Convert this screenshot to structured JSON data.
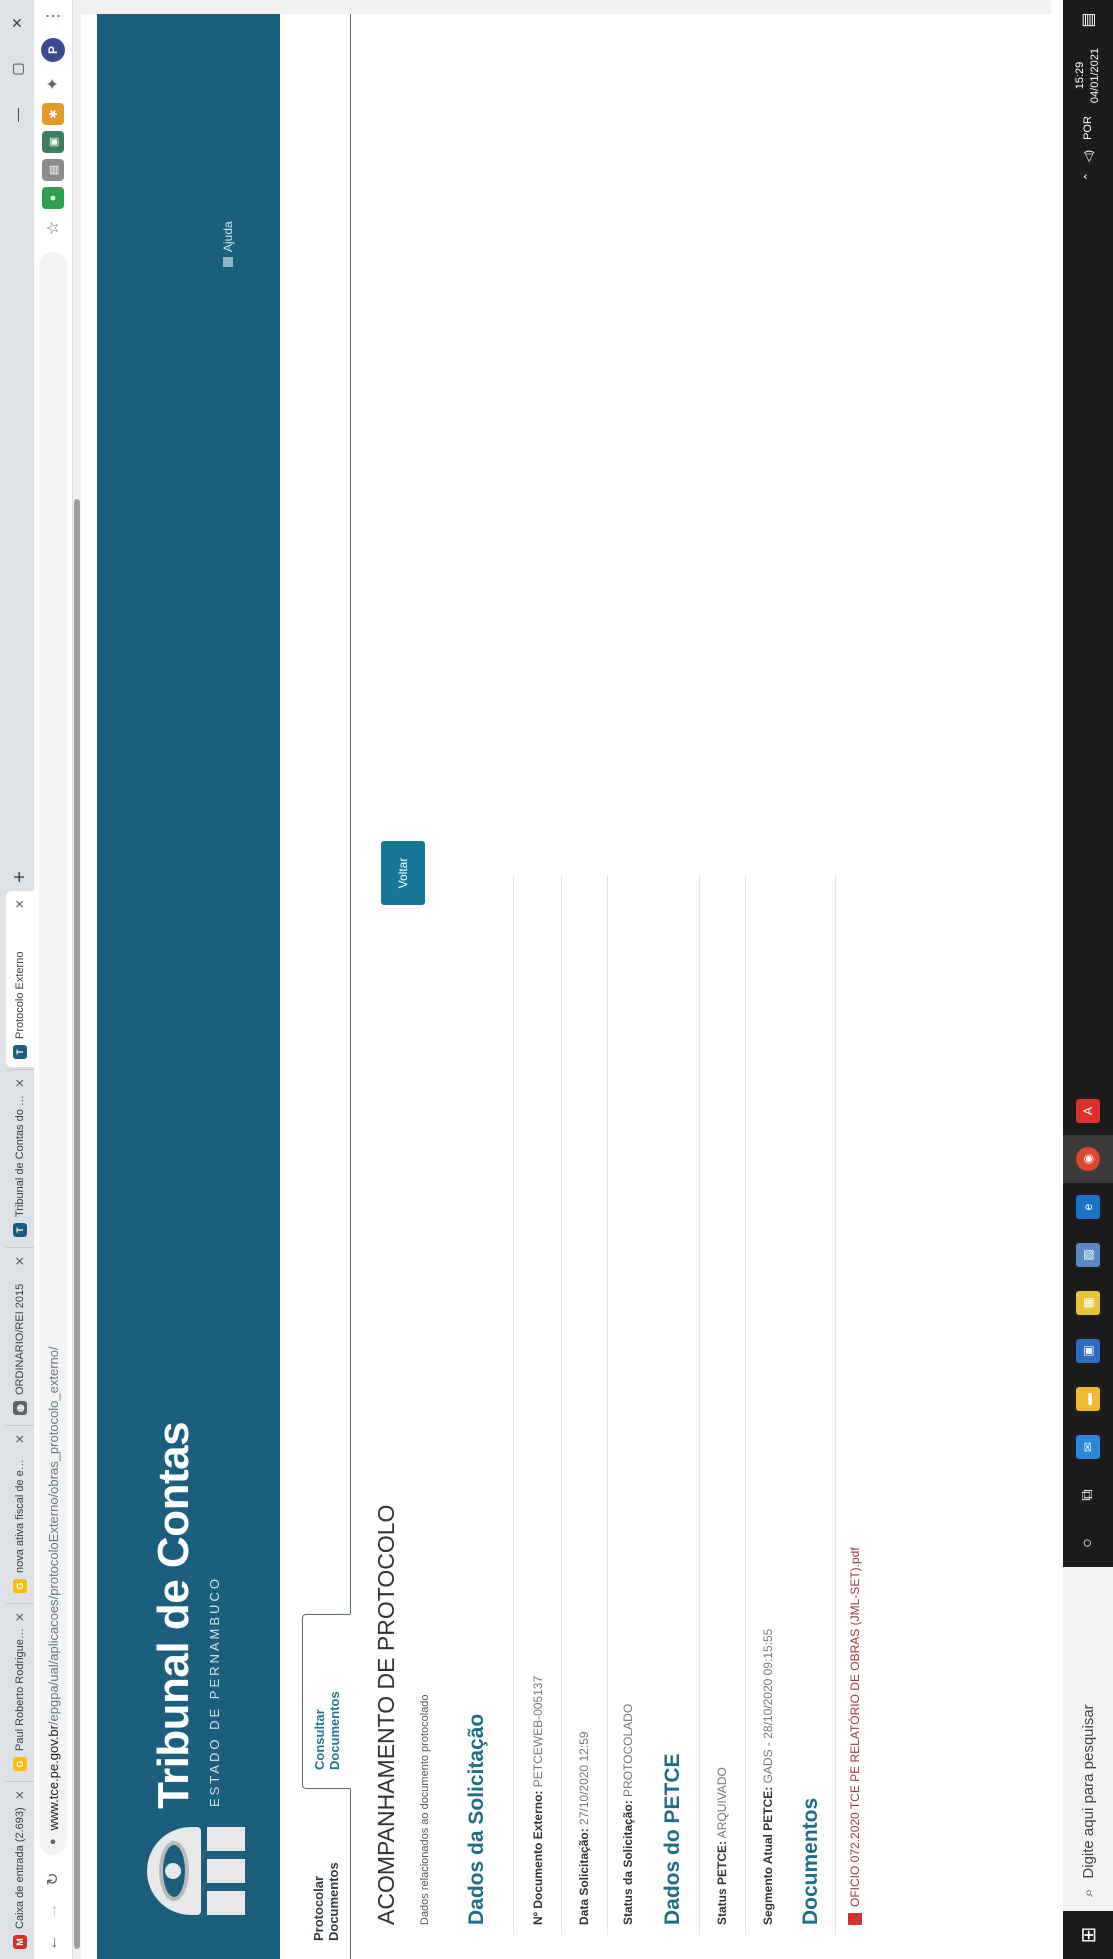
{
  "browser": {
    "tabs": [
      {
        "title": "Caixa de entrada (2.693)",
        "icon": "gmail-icon",
        "color": "#d93025",
        "glyph": "M"
      },
      {
        "title": "Paul Roberto Rodrigues V…",
        "icon": "google-icon",
        "color": "#fbbc05",
        "glyph": "G"
      },
      {
        "title": "nova ativa fiscal de e…",
        "icon": "google-icon",
        "color": "#fbbc05",
        "glyph": "G"
      },
      {
        "title": "ORDINÁRIO/REI 2015",
        "icon": "globe-icon",
        "color": "#5f6368",
        "glyph": "◍"
      },
      {
        "title": "Tribunal de Contas do Esta…",
        "icon": "tce-icon",
        "color": "#1b5e7e",
        "glyph": "T"
      },
      {
        "title": "Protocolo Externo",
        "icon": "tce-icon",
        "color": "#1b5e7e",
        "glyph": "T",
        "active": true
      }
    ],
    "url_host": "www.tce.pe.gov.br",
    "url_path": "/epgpa/ual/aplicacoes/protocoloExterno/obras_protocolo_externo/",
    "new_tab_label": "+",
    "window_controls": {
      "minimize": "—",
      "maximize": "▢",
      "close": "✕"
    },
    "profile_letter": "P"
  },
  "site": {
    "brand_title": "Tribunal de Contas",
    "brand_subtitle": "ESTADO DE PERNAMBUCO",
    "help_link": "Ajuda",
    "accent_color": "#1b5e7e"
  },
  "nav": {
    "tab_protocolar": "Protocolar Documentos",
    "tab_consultar": "Consultar Documentos"
  },
  "main": {
    "heading": "ACOMPANHAMENTO DE PROTOCOLO",
    "description": "Dados relacionados ao documento protocolado",
    "back_button": "Voltar",
    "section_solicitacao": "Dados da Solicitação",
    "doc_externo_label": "Nº Documento Externo:",
    "doc_externo_value": "PETCEWEB-005137",
    "data_solicitacao_label": "Data Solicitação:",
    "data_solicitacao_value": "27/10/2020 12:59",
    "status_solicitacao_label": "Status da Solicitação:",
    "status_solicitacao_value": "PROTOCOLADO",
    "section_petce": "Dados do PETCE",
    "status_petce_label": "Status PETCE:",
    "status_petce_value": "ARQUIVADO",
    "segmento_label": "Segmento Atual PETCE:",
    "segmento_value": "GADS - 28/10/2020 09:15:55",
    "section_documentos": "Documentos",
    "document_file": "OFICIO 072.2020 TCE PE RELATÓRIO DE OBRAS (JML-SET).pdf"
  },
  "taskbar": {
    "search_placeholder": "Digite aqui para pesquisar",
    "language": "POR",
    "time": "15:29",
    "date": "04/01/2021"
  }
}
